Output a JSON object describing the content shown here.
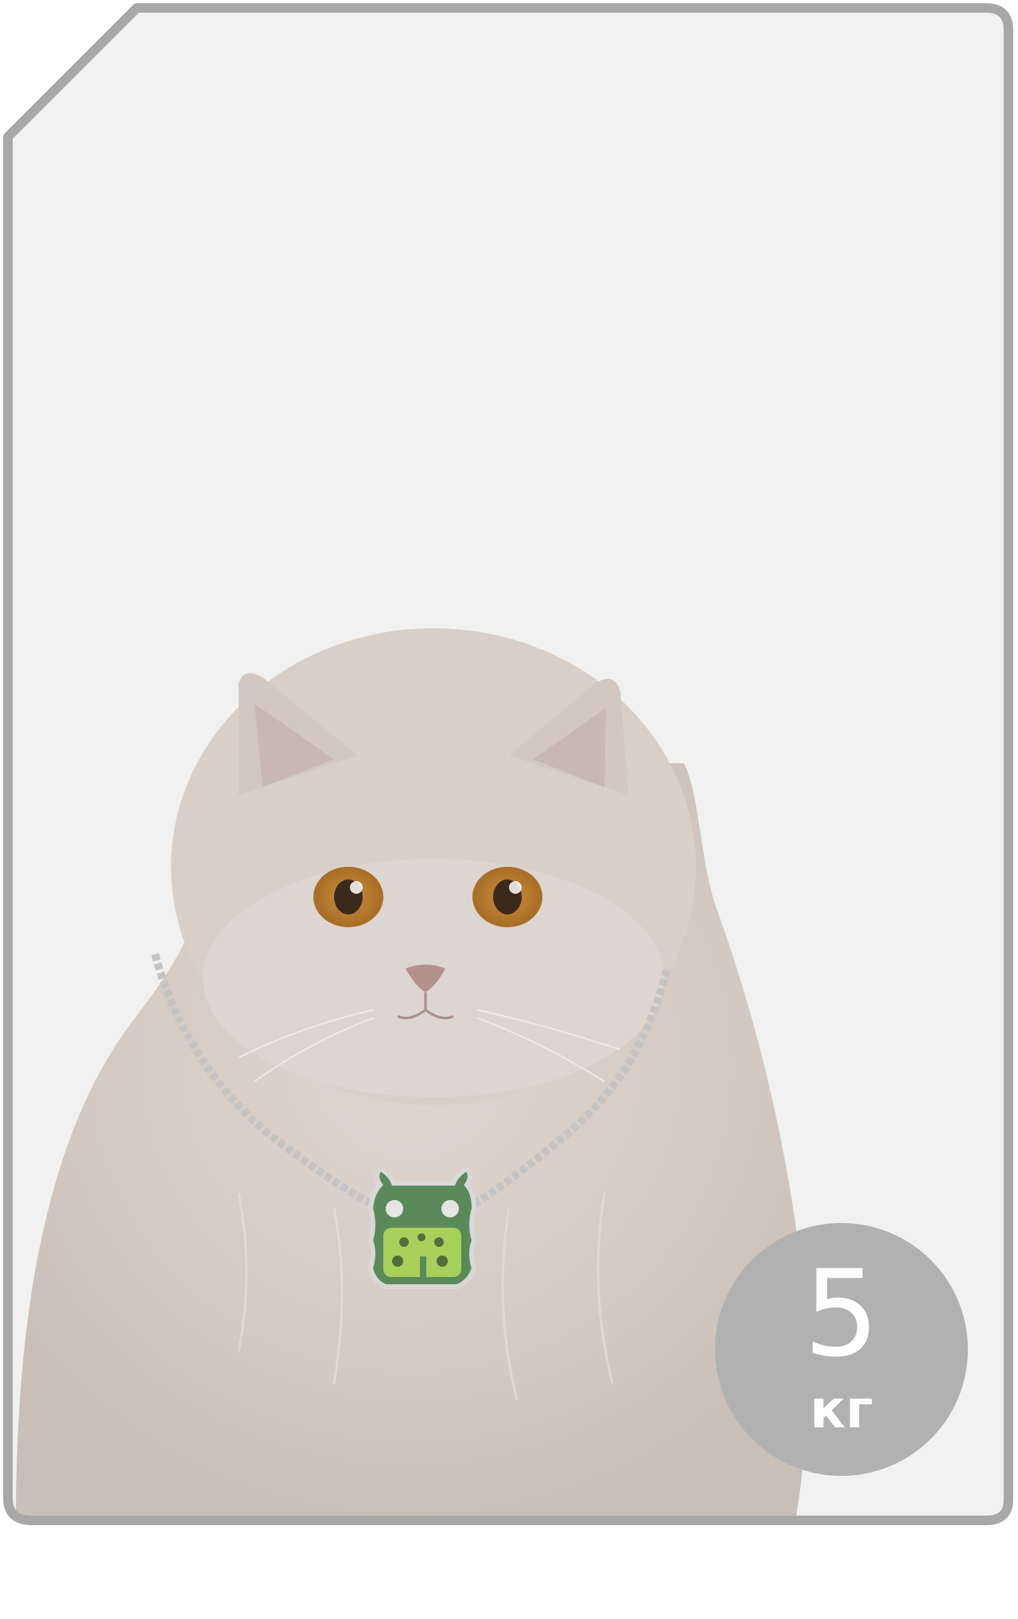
{
  "product_card": {
    "image": "cat-with-pendant-necklace",
    "weight_badge": {
      "value": "5",
      "unit": "кг"
    },
    "colors": {
      "background": "#f1f1f1",
      "border": "#a8a8a8",
      "badge": "#b1b1b1",
      "badge_text": "#ffffff",
      "cat_fur": "#d6cdc6",
      "pendant_green": "#5a8a5a",
      "pendant_lime": "#a8d05a"
    }
  }
}
